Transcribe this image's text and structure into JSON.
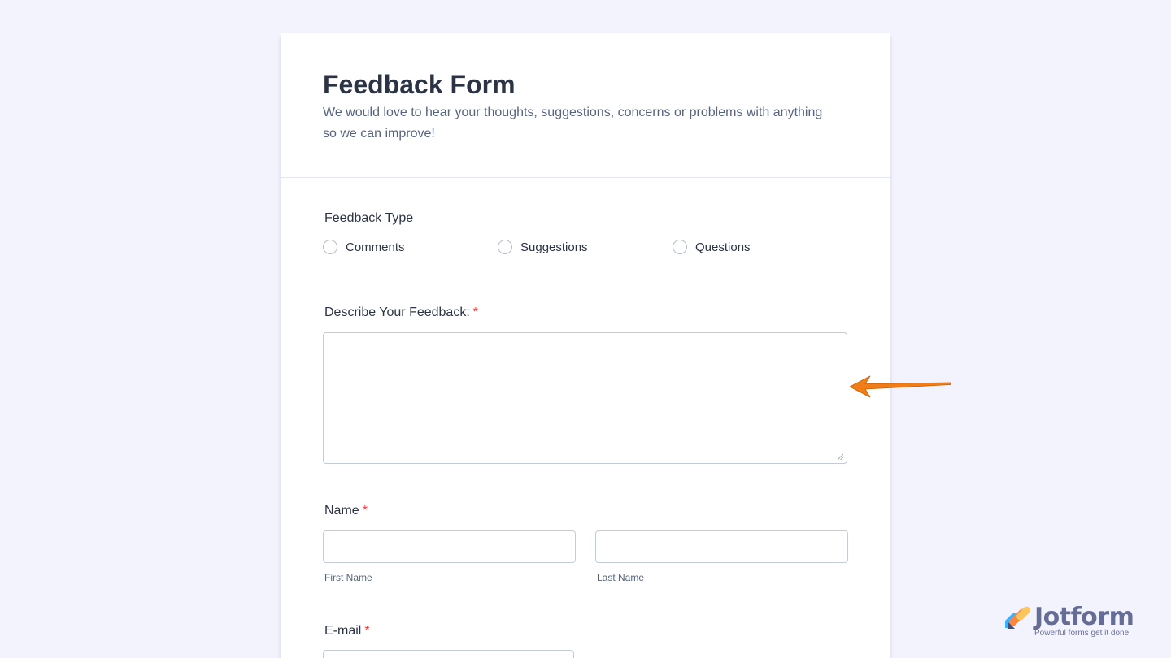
{
  "form": {
    "title": "Feedback Form",
    "subtitle": "We would love to hear your thoughts, suggestions, concerns or problems with anything so we can improve!"
  },
  "feedback_type": {
    "label": "Feedback Type",
    "options": [
      "Comments",
      "Suggestions",
      "Questions"
    ]
  },
  "describe": {
    "label": "Describe Your Feedback:",
    "required_mark": "*"
  },
  "name": {
    "label": "Name",
    "required_mark": "*",
    "first_sublabel": "First Name",
    "last_sublabel": "Last Name"
  },
  "email": {
    "label": "E-mail",
    "required_mark": "*"
  },
  "branding": {
    "name": "Jotform",
    "tagline": "Powerful forms get it done"
  },
  "colors": {
    "background": "#f3f3fe",
    "card": "#ffffff",
    "required": "#f23a3c",
    "arrow": "#f07d15",
    "brand_blue": "#0a1551"
  },
  "icons": {
    "annotation": "arrow-left-icon",
    "logo": "jotform-logo-icon",
    "resize": "resize-grip-icon"
  }
}
